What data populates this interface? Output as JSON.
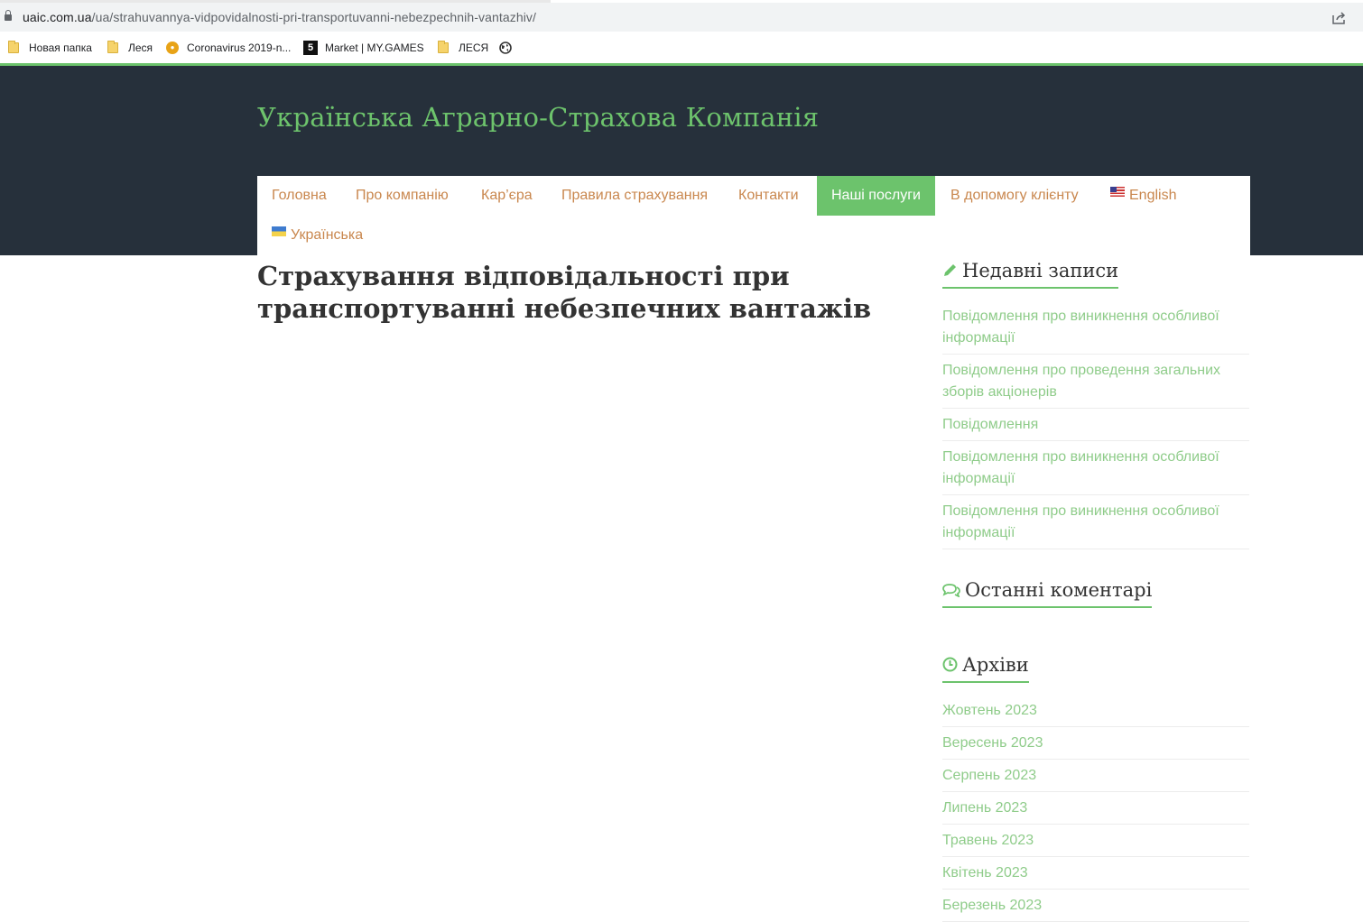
{
  "browser": {
    "url_domain": "uaic.com.ua",
    "url_path": "/ua/strahuvannya-vidpovidalnosti-pri-transportuvanni-nebezpechnih-vantazhiv/",
    "bookmarks": [
      {
        "label": "Новая папка",
        "icon": "folder-icon"
      },
      {
        "label": "Леся",
        "icon": "folder-icon"
      },
      {
        "label": "Coronavirus 2019-n...",
        "icon": "coronavirus-icon"
      },
      {
        "label": "Market | MY.GAMES",
        "icon": "mygames-icon"
      },
      {
        "label": "ЛЕСЯ",
        "icon": "folder-icon"
      }
    ]
  },
  "site": {
    "title": "Українська Аграрно-Страхова Компанія",
    "nav": [
      {
        "label": "Головна"
      },
      {
        "label": "Про компанію"
      },
      {
        "label": "Кар’єра"
      },
      {
        "label": "Правила страхування"
      },
      {
        "label": "Контакти"
      },
      {
        "label": "Наші послуги",
        "active": true
      },
      {
        "label": "В допомогу клієнту"
      },
      {
        "label": "English",
        "icon": "us-flag-icon"
      },
      {
        "label": "Українська",
        "icon": "ua-flag-icon"
      }
    ]
  },
  "main": {
    "title": "Страхування відповідальності при транспортуванні небезпечних вантажів"
  },
  "sidebar": {
    "recent": {
      "title": "Недавні записи",
      "icon": "pencil-icon",
      "items": [
        "Повідомлення про виникнення особливої інформації",
        "Повідомлення про проведення загальних зборів акціонерів",
        "Повідомлення",
        "Повідомлення про виникнення особливої інформації",
        "Повідомлення про виникнення особливої інформації"
      ]
    },
    "comments": {
      "title": "Останні коментарі",
      "icon": "comments-icon"
    },
    "archives": {
      "title": "Архіви",
      "icon": "clock-icon",
      "items": [
        "Жовтень 2023",
        "Вересень 2023",
        "Серпень 2023",
        "Липень 2023",
        "Травень 2023",
        "Квітень 2023",
        "Березень 2023"
      ]
    }
  },
  "colors": {
    "header_bg": "#26303b",
    "accent_green": "#6cc36c",
    "nav_text": "#c9874e",
    "link_green": "#8fcc8a"
  }
}
